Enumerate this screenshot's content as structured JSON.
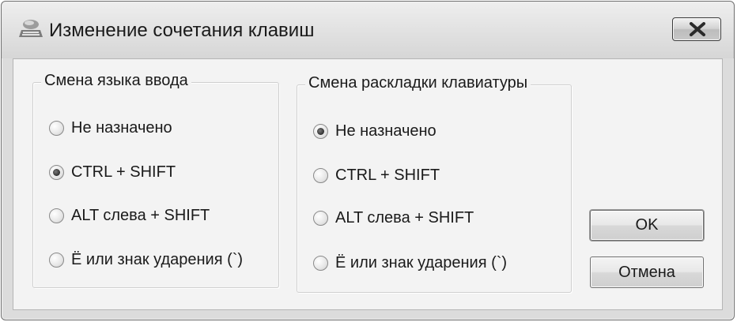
{
  "window": {
    "title": "Изменение сочетания клавиш"
  },
  "input_language_group": {
    "legend": "Смена языка ввода",
    "options": [
      {
        "label": "Не назначено",
        "checked": false
      },
      {
        "label": "CTRL + SHIFT",
        "checked": true
      },
      {
        "label": "ALT слева + SHIFT",
        "checked": false
      },
      {
        "label": "Ё или знак ударения (`)",
        "checked": false
      }
    ]
  },
  "keyboard_layout_group": {
    "legend": "Смена раскладки клавиатуры",
    "options": [
      {
        "label": "Не назначено",
        "checked": true
      },
      {
        "label": "CTRL + SHIFT",
        "checked": false
      },
      {
        "label": "ALT слева + SHIFT",
        "checked": false
      },
      {
        "label": "Ё или знак ударения (`)",
        "checked": false
      }
    ]
  },
  "buttons": {
    "ok": "OK",
    "cancel": "Отмена"
  },
  "icons": {
    "app": "keyboard-icon",
    "close": "close-icon"
  }
}
